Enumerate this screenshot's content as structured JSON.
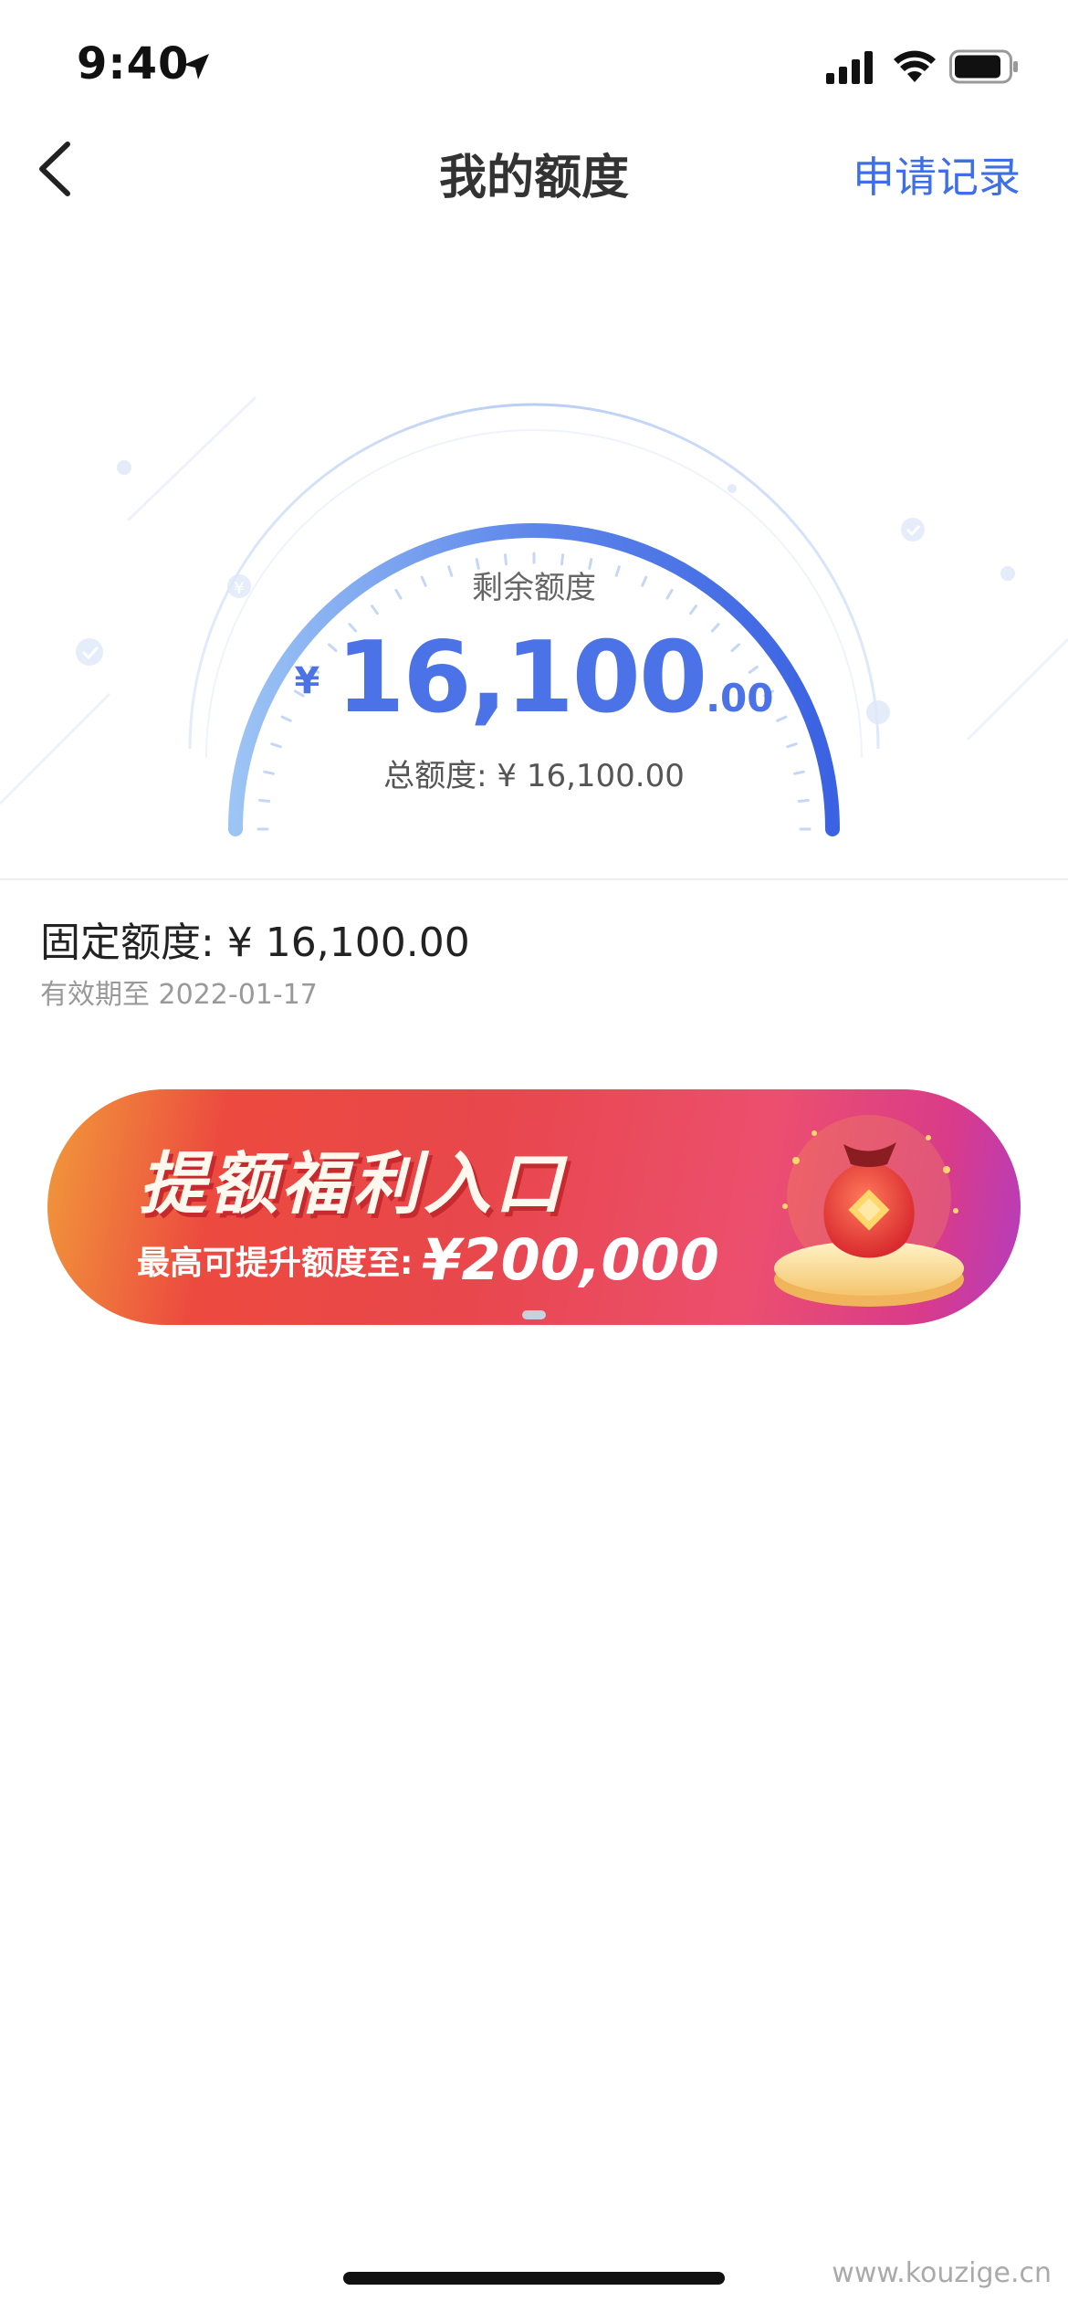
{
  "status": {
    "time": "9:40"
  },
  "nav": {
    "title": "我的额度",
    "record_link": "申请记录"
  },
  "gauge": {
    "label": "剩余额度",
    "currency": "¥",
    "amount_int": "16,100",
    "amount_dec": ".00",
    "total": "总额度: ¥ 16,100.00",
    "fill_ratio": 1.0
  },
  "fixed": {
    "line": "固定额度: ¥ 16,100.00",
    "valid": "有效期至 2022-01-17"
  },
  "banner": {
    "title": "提额福利入口",
    "sub_prefix": "最高可提升额度至:",
    "sub_amount": "¥200,000"
  },
  "footer": {
    "watermark": "www.kouzige.cn"
  },
  "colors": {
    "accent": "#3d6fea",
    "gauge_start": "#8fbaf3",
    "gauge_end": "#3b66e6"
  }
}
